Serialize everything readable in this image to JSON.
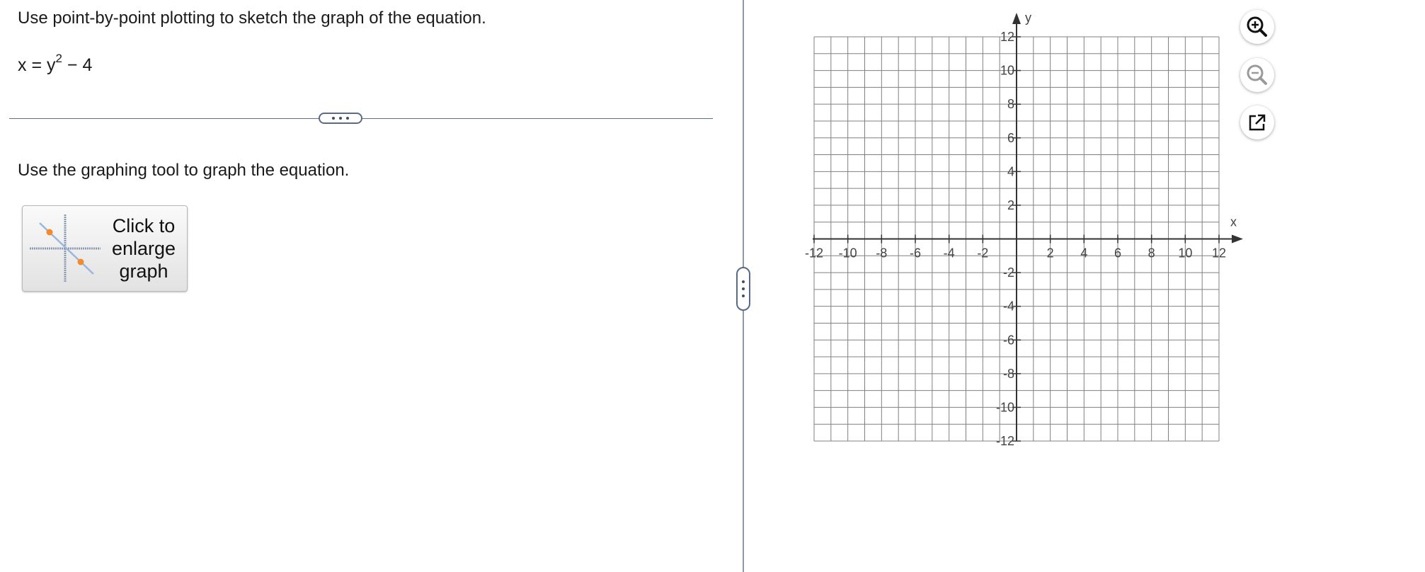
{
  "question": {
    "prompt": "Use point-by-point plotting to sketch the graph of the equation.",
    "equation": {
      "lhs": "x = y",
      "exponent": "2",
      "rhs": " − 4"
    }
  },
  "divider": {
    "expand_label": "•••"
  },
  "instruction": "Use the graphing tool to graph the equation.",
  "enlarge_button": {
    "label": "Click to\nenlarge\ngraph"
  },
  "graph": {
    "x_axis_label": "x",
    "y_axis_label": "y",
    "x_min": -12,
    "x_max": 12,
    "y_min": -12,
    "y_max": 12,
    "grid_step": 1,
    "label_step": 2,
    "x_tick_labels": [
      "-12",
      "-10",
      "-8",
      "-6",
      "-4",
      "-2",
      "2",
      "4",
      "6",
      "8",
      "10",
      "12"
    ],
    "y_tick_labels": [
      "12",
      "10",
      "8",
      "6",
      "4",
      "2",
      "-2",
      "-4",
      "-6",
      "-8",
      "-10",
      "-12"
    ],
    "grid_color": "#808080",
    "axis_color": "#333333"
  },
  "tools": {
    "zoom_in": "zoom-in-icon",
    "zoom_out": "zoom-out-icon",
    "popout": "popout-icon"
  }
}
